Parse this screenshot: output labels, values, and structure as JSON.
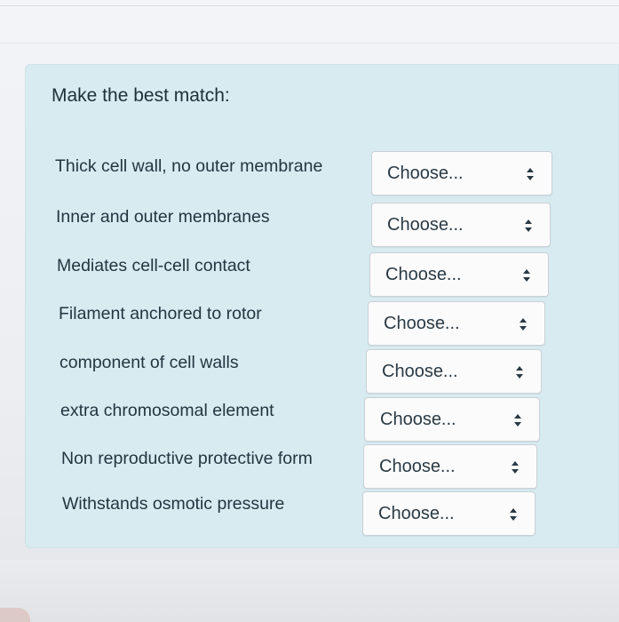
{
  "question": {
    "prompt": "Make the best match:"
  },
  "rows": [
    {
      "label": "Thick cell wall, no outer membrane",
      "selected": "Choose..."
    },
    {
      "label": "Inner and outer membranes",
      "selected": "Choose..."
    },
    {
      "label": "Mediates cell-cell contact",
      "selected": "Choose..."
    },
    {
      "label": "Filament anchored to rotor",
      "selected": "Choose..."
    },
    {
      "label": "component of cell walls",
      "selected": "Choose..."
    },
    {
      "label": "extra chromosomal element",
      "selected": "Choose..."
    },
    {
      "label": "Non reproductive protective form",
      "selected": "Choose..."
    },
    {
      "label": "Withstands osmotic pressure",
      "selected": "Choose..."
    }
  ],
  "colors": {
    "panel_background": "#d7ebf1",
    "select_background": "#fbfbfc",
    "text": "#233640"
  },
  "icons": {
    "select_indicator": "up-down-arrows-icon"
  }
}
